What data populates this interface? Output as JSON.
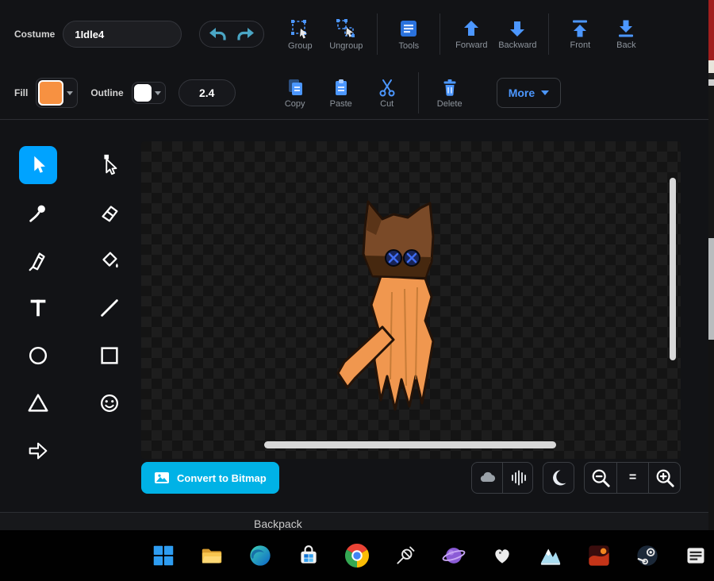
{
  "topbar": {
    "costume_label": "Costume",
    "costume_name": "1Idle4",
    "group": "Group",
    "ungroup": "Ungroup",
    "tools": "Tools",
    "forward": "Forward",
    "backward": "Backward",
    "front": "Front",
    "back": "Back"
  },
  "formatbar": {
    "fill_label": "Fill",
    "fill_color": "#f79141",
    "outline_label": "Outline",
    "outline_color": "#ffffff",
    "stroke_width": "2.4",
    "copy": "Copy",
    "paste": "Paste",
    "cut": "Cut",
    "delete": "Delete",
    "more": "More"
  },
  "palette": {
    "selected_tool": "select",
    "tools": [
      "select",
      "reshape",
      "brush",
      "eraser",
      "pen",
      "fill",
      "text",
      "line",
      "circle",
      "rectangle",
      "triangle",
      "face",
      "arrow"
    ]
  },
  "canvas": {
    "convert_to_bitmap": "Convert to Bitmap",
    "zoom_reset_label": "=",
    "controls": [
      "cloud",
      "waveform",
      "moon",
      "zoom-out",
      "zoom-reset",
      "zoom-in"
    ]
  },
  "backpack": {
    "label": "Backpack"
  },
  "taskbar": {
    "apps": [
      "windows-start",
      "file-explorer",
      "edge",
      "microsoft-store",
      "chrome",
      "satellite",
      "planet",
      "heart",
      "mountain",
      "shooter-game",
      "steam",
      "notes"
    ]
  },
  "colors": {
    "accent_blue": "#4C97FF",
    "undo_teal": "#4aa5c4",
    "selected_tool_bg": "#00a3ff",
    "convert_button_bg": "#00b2e6",
    "fill_orange": "#f79141",
    "canvas_bg": "#141414"
  }
}
